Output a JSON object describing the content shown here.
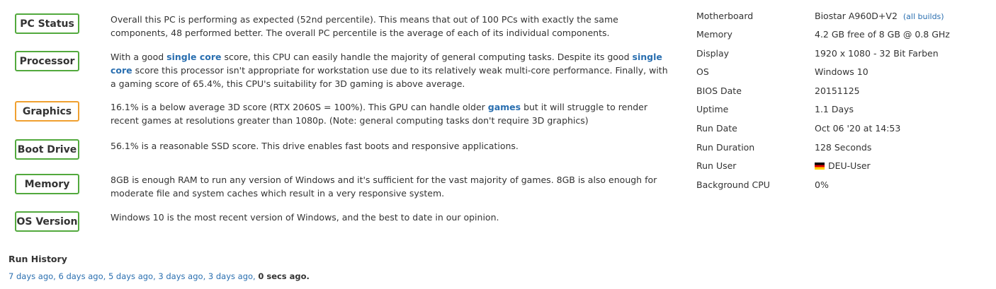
{
  "checks": [
    {
      "name": "PC Status",
      "text_parts": [
        {
          "t": "Overall this PC is performing as expected (52nd percentile). This means that out of 100 PCs with exactly the same components, 48 performed better. The overall PC percentile is the average of each of its individual components."
        }
      ]
    },
    {
      "name": "Processor",
      "text_parts": [
        {
          "t": "With a good "
        },
        {
          "t": "single core",
          "link": true
        },
        {
          "t": " score, this CPU can easily handle the majority of general computing tasks. Despite its good "
        },
        {
          "t": "single core",
          "link": true
        },
        {
          "t": " score this processor isn't appropriate for workstation use due to its relatively weak multi-core performance. Finally, with a gaming score of 65.4%, this CPU's suitability for 3D gaming is above average."
        }
      ]
    },
    {
      "name": "Graphics",
      "status": "warning",
      "text_parts": [
        {
          "t": "16.1% is a below average 3D score (RTX 2060S = 100%). This GPU can handle older "
        },
        {
          "t": "games",
          "link": true
        },
        {
          "t": " but it will struggle to render recent games at resolutions greater than 1080p. (Note: general computing tasks don't require 3D graphics)"
        }
      ]
    },
    {
      "name": "Boot Drive",
      "text_parts": [
        {
          "t": "56.1% is a reasonable SSD score. This drive enables fast boots and responsive applications."
        }
      ]
    },
    {
      "name": "Memory",
      "text_parts": [
        {
          "t": "8GB is enough RAM to run any version of Windows and it's sufficient for the vast majority of games. 8GB is also enough for moderate file and system caches which result in a very responsive system."
        }
      ]
    },
    {
      "name": "OS Version",
      "text_parts": [
        {
          "t": "Windows 10 is the most recent version of Windows, and the best to date in our opinion."
        }
      ]
    }
  ],
  "specs": [
    {
      "label": "Motherboard",
      "value": "Biostar A960D+V2",
      "link": "(all builds)"
    },
    {
      "label": "Memory",
      "value": "4.2 GB free of 8 GB @ 0.8 GHz"
    },
    {
      "label": "Display",
      "value": "1920 x 1080 - 32 Bit Farben"
    },
    {
      "label": "OS",
      "value": "Windows 10"
    },
    {
      "label": "BIOS Date",
      "value": "20151125"
    },
    {
      "label": "Uptime",
      "value": "1.1 Days"
    },
    {
      "label": "Run Date",
      "value": "Oct 06 '20 at 14:53"
    },
    {
      "label": "Run Duration",
      "value": "128 Seconds"
    },
    {
      "label": "Run User",
      "value": "DEU-User",
      "flag": "germany-flag"
    },
    {
      "label": "Background CPU",
      "value": "0%"
    }
  ],
  "colors": {
    "ok": "#52a93d",
    "warning": "#f0a030",
    "link": "#2a6fb0"
  },
  "history": {
    "title": "Run History",
    "links": [
      "7 days ago",
      "6 days ago",
      "5 days ago",
      "3 days ago",
      "3 days ago"
    ],
    "current": "0 secs ago."
  }
}
